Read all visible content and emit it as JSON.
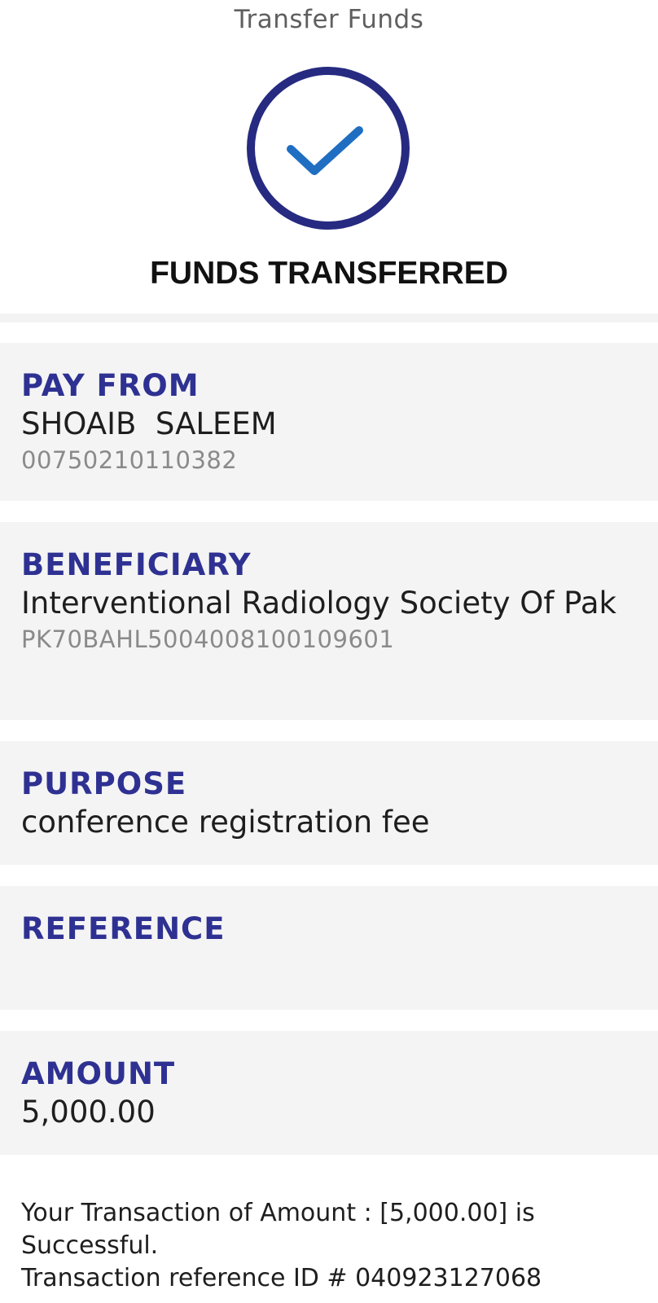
{
  "header": {
    "title": "Transfer Funds"
  },
  "status": {
    "icon": "check-circle-icon",
    "title": "FUNDS TRANSFERRED",
    "ring_color": "#262a80",
    "check_color": "#1f6ec2"
  },
  "pay_from": {
    "label": "PAY FROM",
    "name": "SHOAIB  SALEEM",
    "account": "00750210110382"
  },
  "beneficiary": {
    "label": "BENEFICIARY",
    "name": "Interventional Radiology Society Of Pak",
    "account": "PK70BAHL5004008100109601"
  },
  "purpose": {
    "label": "PURPOSE",
    "value": "conference registration fee"
  },
  "reference": {
    "label": "REFERENCE",
    "value": ""
  },
  "amount": {
    "label": "AMOUNT",
    "value": "5,000.00"
  },
  "footer": {
    "line1": "Your Transaction of Amount : [5,000.00] is",
    "line2": "Successful.",
    "line3": "Transaction reference ID # 040923127068"
  },
  "colors": {
    "accent": "#2e3192",
    "card_background": "#f4f4f4"
  }
}
